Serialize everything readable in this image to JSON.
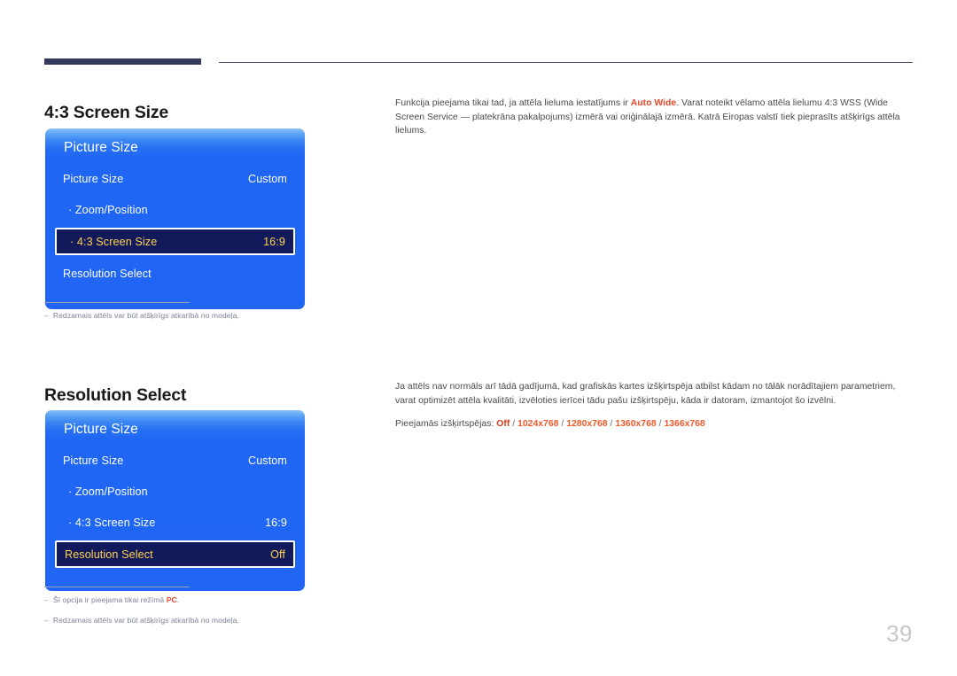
{
  "document": {
    "page_number": "39"
  },
  "sections": [
    {
      "heading": "4:3 Screen Size",
      "osd": {
        "title": "Picture Size",
        "rows": [
          {
            "label": "Picture Size",
            "value": "Custom",
            "indent": false,
            "selected": false
          },
          {
            "label": "· Zoom/Position",
            "value": "",
            "indent": true,
            "selected": false
          },
          {
            "label": "· 4:3 Screen Size",
            "value": "16:9",
            "indent": true,
            "selected": true
          },
          {
            "label": "Resolution Select",
            "value": "",
            "indent": false,
            "selected": false
          }
        ]
      },
      "footnotes": [
        {
          "dash": "–",
          "text": "Redzamais attēls var būt atšķirīgs atkarībā no modeļa."
        }
      ],
      "body": {
        "paragraph_parts": [
          {
            "text": "Funkcija pieejama tikai tad, ja attēla lieluma iestatījums ir ",
            "style": "normal"
          },
          {
            "text": "Auto Wide",
            "style": "red"
          },
          {
            "text": ". Varat noteikt vēlamo attēla lielumu 4:3 WSS (Wide Screen Service — platekrāna pakalpojums) izmērā vai oriģinālajā izmērā. Katrā Eiropas valstī tiek pieprdasīts atšķirīgs attēla lielums.",
            "style": "normal"
          }
        ],
        "paragraph_plain": "Funkcija pieejama tikai tad, ja attēla lieluma iestatījums ir Auto Wide. Varat noteikt vēlamo attēla lielumu 4:3 WSS (Wide Screen Service — platekrāna pakalpojums) izmērā vai oriģinālajā izmērā. Katrā Eiropas valstī tiek pieprasīts atšķirīgs attēla lielums.",
        "prefix": "Funkcija pieejama tikai tad, ja attēla lieluma iestatījums ir ",
        "accent": "Auto Wide",
        "suffix": ". Varat noteikt vēlamo attēla lielumu 4:3 WSS (Wide Screen Service — platekrāna pakalpojums) izmērā vai oriģinālajā izmērā. Katrā Eiropas valstī tiek pieprasīts atšķirīgs attēla lielums."
      }
    },
    {
      "heading": "Resolution Select",
      "osd": {
        "title": "Picture Size",
        "rows": [
          {
            "label": "Picture Size",
            "value": "Custom",
            "indent": false,
            "selected": false
          },
          {
            "label": "· Zoom/Position",
            "value": "",
            "indent": true,
            "selected": false
          },
          {
            "label": "· 4:3 Screen Size",
            "value": "16:9",
            "indent": true,
            "selected": false
          },
          {
            "label": "Resolution Select",
            "value": "Off",
            "indent": false,
            "selected": true
          }
        ]
      },
      "footnotes": [
        {
          "dash": "–",
          "text_prefix": "Šī opcija ir pieejama tikai režīmā ",
          "text_accent": "PC",
          "text_suffix": "."
        },
        {
          "dash": "–",
          "text": "Redzamais attēls var būt atšķirīgs atkarībā no modeļa."
        }
      ],
      "body": {
        "paragraph_plain": "Ja attēls nav normāls arī tādā gadījumā, kad grafiskās kartes izšķirtspēja atbilst kādam no tālāk norādītajiem parametriem, varat optimizēt attēla kvalitāti, izvēloties ierīcei tādu pašu izšķirtspēju, kāda ir datoram, izmantojot šo izvēlni.",
        "resolutions_label": "Pieejamās izšķirtspējas: ",
        "resolutions_first": "Off",
        "resolutions_rest": [
          "1024x768",
          "1280x768",
          "1360x768",
          "1366x768"
        ],
        "separator": " / "
      }
    }
  ],
  "colors": {
    "accent_red": "#e8472c",
    "resolution_orange": "#ef5a2a",
    "osd_blue": "#1f66f5",
    "osd_selected_bg": "#131a5c",
    "osd_selected_text": "#ffd24d",
    "rule_navy": "#343a5e"
  }
}
